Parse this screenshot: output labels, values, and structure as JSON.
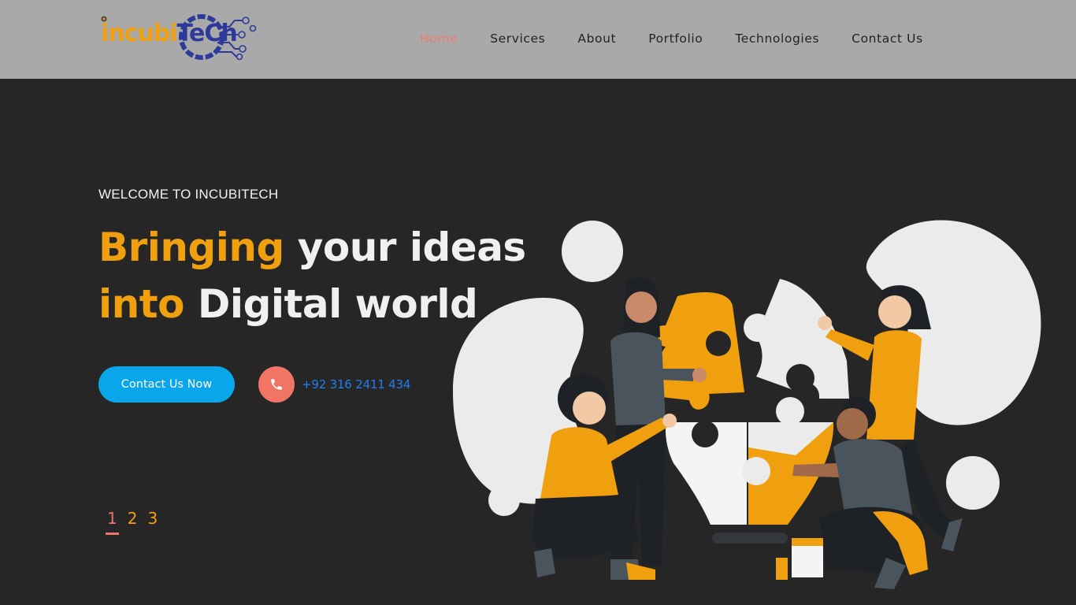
{
  "logo": {
    "text_part1": "incubi",
    "text_part2": "TeCh"
  },
  "nav": {
    "items": [
      {
        "label": "Home",
        "active": true
      },
      {
        "label": "Services",
        "active": false
      },
      {
        "label": "About",
        "active": false
      },
      {
        "label": "Portfolio",
        "active": false
      },
      {
        "label": "Technologies",
        "active": false
      },
      {
        "label": "Contact Us",
        "active": false
      }
    ]
  },
  "hero": {
    "welcome": "WELCOME TO INCUBITECH",
    "line1_accent": "Bringing",
    "line1_rest": "your ideas",
    "line2_accent": "into",
    "line2_rest": "Digital world",
    "cta_label": "Contact Us Now",
    "phone": "+92 316 2411 434"
  },
  "slider": {
    "pages": [
      "1",
      "2",
      "3"
    ],
    "current": "1"
  },
  "colors": {
    "accent_orange": "#f0a00f",
    "cta_blue": "#0aa6eb",
    "phone_coral": "#f07565",
    "background": "#262627",
    "header": "#a9a9aa"
  },
  "icons": {
    "phone": "phone-icon",
    "logo_circuit": "circuit-logo-icon"
  }
}
